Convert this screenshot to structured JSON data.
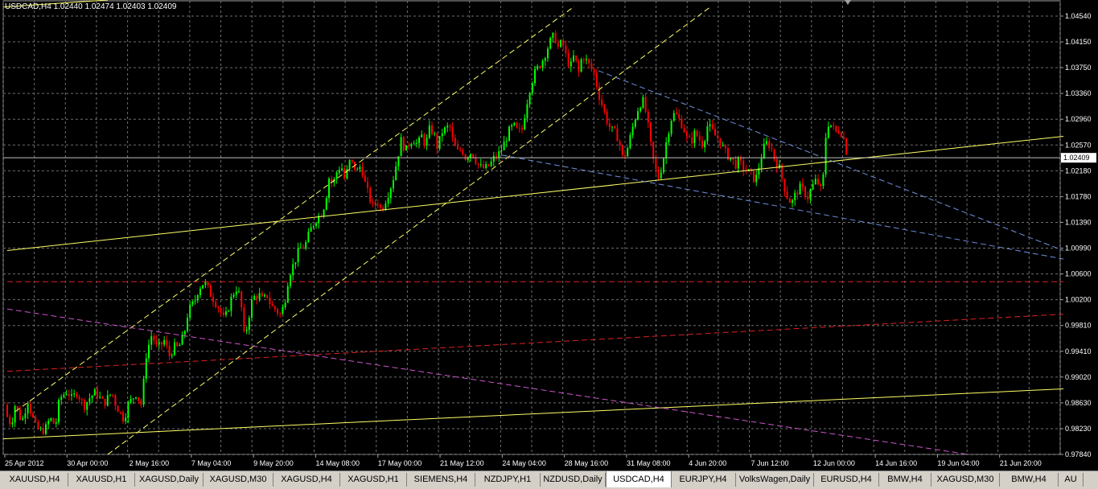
{
  "header": {
    "symbol_title": "USDCAD,H4  1.02440 1.02474 1.02403 1.02409"
  },
  "colors": {
    "background": "#000000",
    "grid": "#6e6e6e",
    "axis_text": "#ffffff",
    "bull_candle": "#00ff00",
    "bear_candle": "#ff0000",
    "trend_yellow": "#ffff66",
    "trend_blue": "#6f8fdd",
    "trend_red": "#dd2222",
    "trend_magenta": "#cc55cc",
    "price_line": "#c0c0c0"
  },
  "tabs": [
    {
      "label": "XAUUSD,H4",
      "active": false
    },
    {
      "label": "XAUUSD,H1",
      "active": false
    },
    {
      "label": "XAGUSD,Daily",
      "active": false
    },
    {
      "label": "XAGUSD,M30",
      "active": false
    },
    {
      "label": "XAGUSD,H4",
      "active": false
    },
    {
      "label": "XAGUSD,H1",
      "active": false
    },
    {
      "label": "SIEMENS,H4",
      "active": false
    },
    {
      "label": "NZDJPY,H1",
      "active": false
    },
    {
      "label": "NZDUSD,Daily",
      "active": false
    },
    {
      "label": "USDCAD,H4",
      "active": true
    },
    {
      "label": "EURJPY,H4",
      "active": false
    },
    {
      "label": "VolksWagen,Daily",
      "active": false
    },
    {
      "label": "EURUSD,H4",
      "active": false
    },
    {
      "label": "BMW,H4",
      "active": false
    },
    {
      "label": "XAGUSD,M30",
      "active": false
    },
    {
      "label": "BMW,H4",
      "active": false
    },
    {
      "label": "AU",
      "active": false
    }
  ],
  "chart_data": {
    "type": "candlestick",
    "symbol": "USDCAD",
    "timeframe": "H4",
    "ylim": [
      0.9784,
      1.0474
    ],
    "current_price": "1.02409",
    "y_ticks": [
      "1.04540",
      "1.04150",
      "1.03750",
      "1.03360",
      "1.02960",
      "1.02570",
      "1.02180",
      "1.01780",
      "1.01390",
      "1.00990",
      "1.00600",
      "1.00200",
      "0.99810",
      "0.99410",
      "0.99020",
      "0.98630",
      "0.98230",
      "0.97840"
    ],
    "x_ticks": [
      "25 Apr 2012",
      "30 Apr 00:00",
      "2 May 16:00",
      "7 May 04:00",
      "9 May 20:00",
      "14 May 08:00",
      "17 May 00:00",
      "21 May 12:00",
      "24 May 04:00",
      "28 May 16:00",
      "31 May 08:00",
      "4 Jun 20:00",
      "7 Jun 12:00",
      "12 Jun 00:00",
      "14 Jun 16:00",
      "19 Jun 04:00",
      "21 Jun 20:00"
    ],
    "price_path": [
      [
        0,
        0.986
      ],
      [
        5,
        0.9842
      ],
      [
        10,
        0.983
      ],
      [
        15,
        0.9862
      ],
      [
        20,
        0.9842
      ],
      [
        25,
        0.9838
      ],
      [
        30,
        0.987
      ],
      [
        35,
        0.9846
      ],
      [
        40,
        0.9828
      ],
      [
        45,
        0.982
      ],
      [
        52,
        0.9822
      ],
      [
        58,
        0.984
      ],
      [
        65,
        0.9828
      ],
      [
        70,
        0.987
      ],
      [
        80,
        0.9882
      ],
      [
        85,
        0.987
      ],
      [
        92,
        0.988
      ],
      [
        100,
        0.9858
      ],
      [
        108,
        0.9872
      ],
      [
        115,
        0.988
      ],
      [
        125,
        0.9862
      ],
      [
        135,
        0.988
      ],
      [
        140,
        0.986
      ],
      [
        150,
        0.9838
      ],
      [
        155,
        0.986
      ],
      [
        165,
        0.9878
      ],
      [
        172,
        0.986
      ],
      [
        178,
        0.994
      ],
      [
        185,
        0.997
      ],
      [
        190,
        0.995
      ],
      [
        195,
        0.995
      ],
      [
        200,
        0.996
      ],
      [
        207,
        0.9935
      ],
      [
        212,
        0.995
      ],
      [
        218,
        0.9948
      ],
      [
        225,
        0.997
      ],
      [
        230,
        1.0005
      ],
      [
        238,
        1.002
      ],
      [
        243,
        1.004
      ],
      [
        250,
        1.005
      ],
      [
        258,
        1.003
      ],
      [
        263,
        1.002
      ],
      [
        268,
        1.001
      ],
      [
        275,
        0.999
      ],
      [
        280,
        1.001
      ],
      [
        285,
        1.003
      ],
      [
        290,
        1.004
      ],
      [
        295,
        1.0025
      ],
      [
        300,
        0.996
      ],
      [
        305,
        0.9995
      ],
      [
        310,
        1.0025
      ],
      [
        318,
        1.003
      ],
      [
        323,
        1.002
      ],
      [
        328,
        1.003
      ],
      [
        333,
        1.0012
      ],
      [
        338,
        1.0008
      ],
      [
        345,
        0.9998
      ],
      [
        350,
        1.002
      ],
      [
        355,
        1.006
      ],
      [
        362,
        1.008
      ],
      [
        368,
        1.01
      ],
      [
        375,
        1.0105
      ],
      [
        382,
        1.013
      ],
      [
        388,
        1.0145
      ],
      [
        395,
        1.0155
      ],
      [
        400,
        1.017
      ],
      [
        405,
        1.021
      ],
      [
        410,
        1.02
      ],
      [
        415,
        1.022
      ],
      [
        420,
        1.023
      ],
      [
        425,
        1.0205
      ],
      [
        430,
        1.0235
      ],
      [
        435,
        1.023
      ],
      [
        440,
        1.022
      ],
      [
        445,
        1.023
      ],
      [
        450,
        1.02
      ],
      [
        455,
        1.018
      ],
      [
        460,
        1.0165
      ],
      [
        465,
        1.0175
      ],
      [
        470,
        1.016
      ],
      [
        475,
        1.0175
      ],
      [
        480,
        1.019
      ],
      [
        485,
        1.021
      ],
      [
        490,
        1.024
      ],
      [
        495,
        1.027
      ],
      [
        500,
        1.025
      ],
      [
        505,
        1.0265
      ],
      [
        510,
        1.027
      ],
      [
        515,
        1.026
      ],
      [
        520,
        1.0275
      ],
      [
        525,
        1.026
      ],
      [
        530,
        1.0285
      ],
      [
        535,
        1.028
      ],
      [
        540,
        1.0255
      ],
      [
        545,
        1.028
      ],
      [
        550,
        1.0285
      ],
      [
        555,
        1.029
      ],
      [
        560,
        1.026
      ],
      [
        565,
        1.025
      ],
      [
        570,
        1.0255
      ],
      [
        575,
        1.024
      ],
      [
        580,
        1.025
      ],
      [
        585,
        1.0245
      ],
      [
        590,
        1.023
      ],
      [
        595,
        1.0225
      ],
      [
        600,
        1.0225
      ],
      [
        605,
        1.023
      ],
      [
        610,
        1.024
      ],
      [
        615,
        1.0245
      ],
      [
        620,
        1.0255
      ],
      [
        625,
        1.027
      ],
      [
        630,
        1.0285
      ],
      [
        635,
        1.029
      ],
      [
        640,
        1.028
      ],
      [
        645,
        1.0285
      ],
      [
        650,
        1.032
      ],
      [
        655,
        1.035
      ],
      [
        660,
        1.037
      ],
      [
        665,
        1.038
      ],
      [
        670,
        1.039
      ],
      [
        675,
        1.0405
      ],
      [
        680,
        1.042
      ],
      [
        685,
        1.043
      ],
      [
        690,
        1.041
      ],
      [
        695,
        1.042
      ],
      [
        700,
        1.0395
      ],
      [
        705,
        1.038
      ],
      [
        710,
        1.04
      ],
      [
        715,
        1.037
      ],
      [
        720,
        1.04
      ],
      [
        725,
        1.039
      ],
      [
        730,
        1.038
      ],
      [
        735,
        1.037
      ],
      [
        740,
        1.034
      ],
      [
        745,
        1.032
      ],
      [
        750,
        1.03
      ],
      [
        755,
        1.0285
      ],
      [
        760,
        1.028
      ],
      [
        765,
        1.027
      ],
      [
        770,
        1.024
      ],
      [
        775,
        1.025
      ],
      [
        780,
        1.0275
      ],
      [
        785,
        1.03
      ],
      [
        790,
        1.032
      ],
      [
        795,
        1.033
      ],
      [
        800,
        1.0305
      ],
      [
        805,
        1.026
      ],
      [
        810,
        1.0225
      ],
      [
        815,
        1.021
      ],
      [
        820,
        1.0235
      ],
      [
        825,
        1.027
      ],
      [
        830,
        1.03
      ],
      [
        835,
        1.031
      ],
      [
        840,
        1.03
      ],
      [
        845,
        1.029
      ],
      [
        850,
        1.027
      ],
      [
        855,
        1.0265
      ],
      [
        860,
        1.028
      ],
      [
        865,
        1.027
      ],
      [
        870,
        1.026
      ],
      [
        875,
        1.029
      ],
      [
        880,
        1.0285
      ],
      [
        885,
        1.0275
      ],
      [
        890,
        1.027
      ],
      [
        895,
        1.0255
      ],
      [
        900,
        1.0245
      ],
      [
        905,
        1.024
      ],
      [
        910,
        1.023
      ],
      [
        915,
        1.0235
      ],
      [
        920,
        1.0225
      ],
      [
        925,
        1.022
      ],
      [
        930,
        1.0215
      ],
      [
        935,
        1.0205
      ],
      [
        940,
        1.023
      ],
      [
        945,
        1.0255
      ],
      [
        950,
        1.0265
      ],
      [
        955,
        1.0255
      ],
      [
        960,
        1.0235
      ],
      [
        965,
        1.0225
      ],
      [
        970,
        1.02
      ],
      [
        975,
        1.018
      ],
      [
        980,
        1.017
      ],
      [
        985,
        1.0185
      ],
      [
        990,
        1.0195
      ],
      [
        995,
        1.019
      ],
      [
        1000,
        1.018
      ],
      [
        1005,
        1.0195
      ],
      [
        1010,
        1.0205
      ],
      [
        1015,
        1.02
      ],
      [
        1018,
        1.018
      ],
      [
        1022,
        1.027
      ],
      [
        1026,
        1.0295
      ],
      [
        1030,
        1.029
      ],
      [
        1035,
        1.028
      ],
      [
        1040,
        1.0285
      ],
      [
        1045,
        1.027
      ],
      [
        1050,
        1.0241
      ]
    ],
    "lines": [
      {
        "style": "solid",
        "color": "yellow",
        "from": [
          0,
          1.0473
        ],
        "to": [
          130,
          1.0484
        ]
      },
      {
        "style": "dashed",
        "color": "yellow",
        "from": [
          15,
          0.985
        ],
        "to": [
          710,
          1.0474
        ]
      },
      {
        "style": "dashed",
        "color": "yellow",
        "from": [
          130,
          0.9784
        ],
        "to": [
          880,
          1.0474
        ]
      },
      {
        "style": "solid",
        "color": "yellow",
        "from": [
          5,
          1.0098
        ],
        "to": [
          1318,
          1.0274
        ]
      },
      {
        "style": "solid",
        "color": "yellow",
        "from": [
          0,
          0.9808
        ],
        "to": [
          1318,
          0.9885
        ]
      },
      {
        "style": "dashed",
        "color": "blue",
        "from": [
          620,
          1.0245
        ],
        "to": [
          1318,
          1.0085
        ]
      },
      {
        "style": "dashed",
        "color": "blue",
        "from": [
          740,
          1.0375
        ],
        "to": [
          1318,
          1.0098
        ]
      },
      {
        "style": "dashed",
        "color": "red",
        "from": [
          5,
          1.005
        ],
        "to": [
          1318,
          1.005
        ]
      },
      {
        "style": "dashed",
        "color": "red",
        "from": [
          5,
          0.9912
        ],
        "to": [
          1318,
          1.0
        ]
      },
      {
        "style": "dashed",
        "color": "magenta",
        "from": [
          5,
          1.0008
        ],
        "to": [
          1200,
          0.9784
        ]
      }
    ]
  }
}
